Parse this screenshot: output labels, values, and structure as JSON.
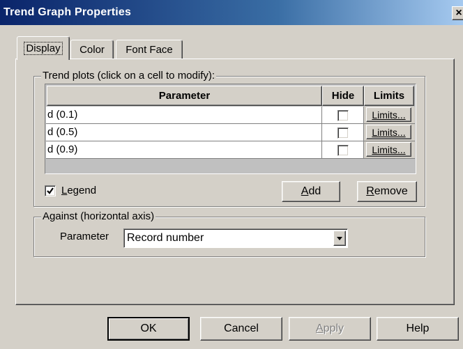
{
  "window": {
    "title": "Trend Graph Properties",
    "close_glyph": "×"
  },
  "tabs": [
    {
      "label": "Display",
      "active": true
    },
    {
      "label": "Color",
      "active": false
    },
    {
      "label": "Font Face",
      "active": false
    }
  ],
  "trend_plots": {
    "group_label": "Trend plots (click on a cell to modify):",
    "columns": {
      "parameter": "Parameter",
      "hide": "Hide",
      "limits": "Limits"
    },
    "rows": [
      {
        "parameter": "d (0.1)",
        "hide": false,
        "limits_label": "Limits..."
      },
      {
        "parameter": "d (0.5)",
        "hide": false,
        "limits_label": "Limits..."
      },
      {
        "parameter": "d (0.9)",
        "hide": false,
        "limits_label": "Limits..."
      }
    ],
    "legend": {
      "label_first": "L",
      "label_rest": "egend",
      "checked": true
    },
    "add": {
      "mnemonic": "A",
      "rest": "dd"
    },
    "remove": {
      "mnemonic": "R",
      "rest": "emove"
    }
  },
  "against": {
    "group_label": "Against (horizontal axis)",
    "parameter_label": "Parameter",
    "selected": "Record number"
  },
  "footer": {
    "ok": "OK",
    "cancel": "Cancel",
    "apply": {
      "mnemonic": "A",
      "rest": "pply",
      "disabled": true
    },
    "help": "Help"
  },
  "icons": {
    "close": "close-icon",
    "check": "check-icon",
    "dropdown": "dropdown-arrow-icon"
  }
}
